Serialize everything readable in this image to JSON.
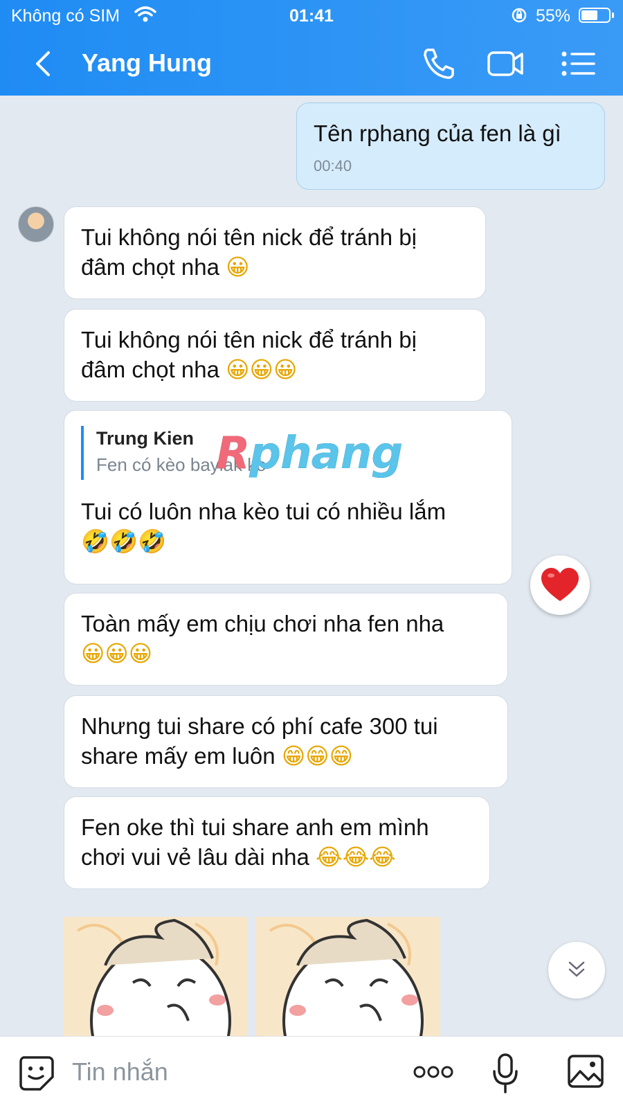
{
  "status_bar": {
    "carrier": "Không có SIM",
    "time": "01:41",
    "battery": "55%",
    "battery_level": 0.55
  },
  "header": {
    "contact_name": "Yang Hung",
    "icons": [
      "back-icon",
      "phone-icon",
      "video-icon",
      "menu-icon"
    ]
  },
  "messages": [
    {
      "type": "sent",
      "text": "Tên rphang của fen là gì",
      "time": "00:40"
    },
    {
      "type": "received",
      "lines": [
        "Tui không nói tên nick để tránh bị",
        "đâm chọt nha"
      ],
      "emoji": "😀"
    },
    {
      "type": "received",
      "lines": [
        "Tui không nói tên nick để tránh bị",
        "đâm chọt nha"
      ],
      "emoji": "😀😀😀"
    },
    {
      "type": "received_quote",
      "quote_name": "Trung Kien",
      "quote_text": "Fen có kèo baylak ko",
      "lines": [
        "Tui có luôn nha kèo tui có nhiều lắm"
      ],
      "emoji": "🤣🤣🤣"
    },
    {
      "type": "received",
      "lines": [
        "Toàn mấy em chịu chơi nha fen nha"
      ],
      "emoji": "😀😀😀"
    },
    {
      "type": "received",
      "lines": [
        "Nhưng tui share có phí cafe 300 tui",
        "share mấy em luôn"
      ],
      "emoji": "😁😁😁"
    },
    {
      "type": "received",
      "lines": [
        "Fen oke thì tui share anh em mình",
        "chơi vui vẻ lâu dài nha"
      ],
      "emoji": "😂😂😂"
    }
  ],
  "watermark": "Rphang",
  "reaction": "❤️",
  "input": {
    "placeholder": "Tin nhắn",
    "icons": [
      "sticker-icon",
      "more-icon",
      "mic-icon",
      "image-icon"
    ]
  },
  "colors": {
    "header": "#1f8cf4",
    "sent_bubble": "#d5ecfd",
    "chat_bg": "#e2e9f1"
  }
}
